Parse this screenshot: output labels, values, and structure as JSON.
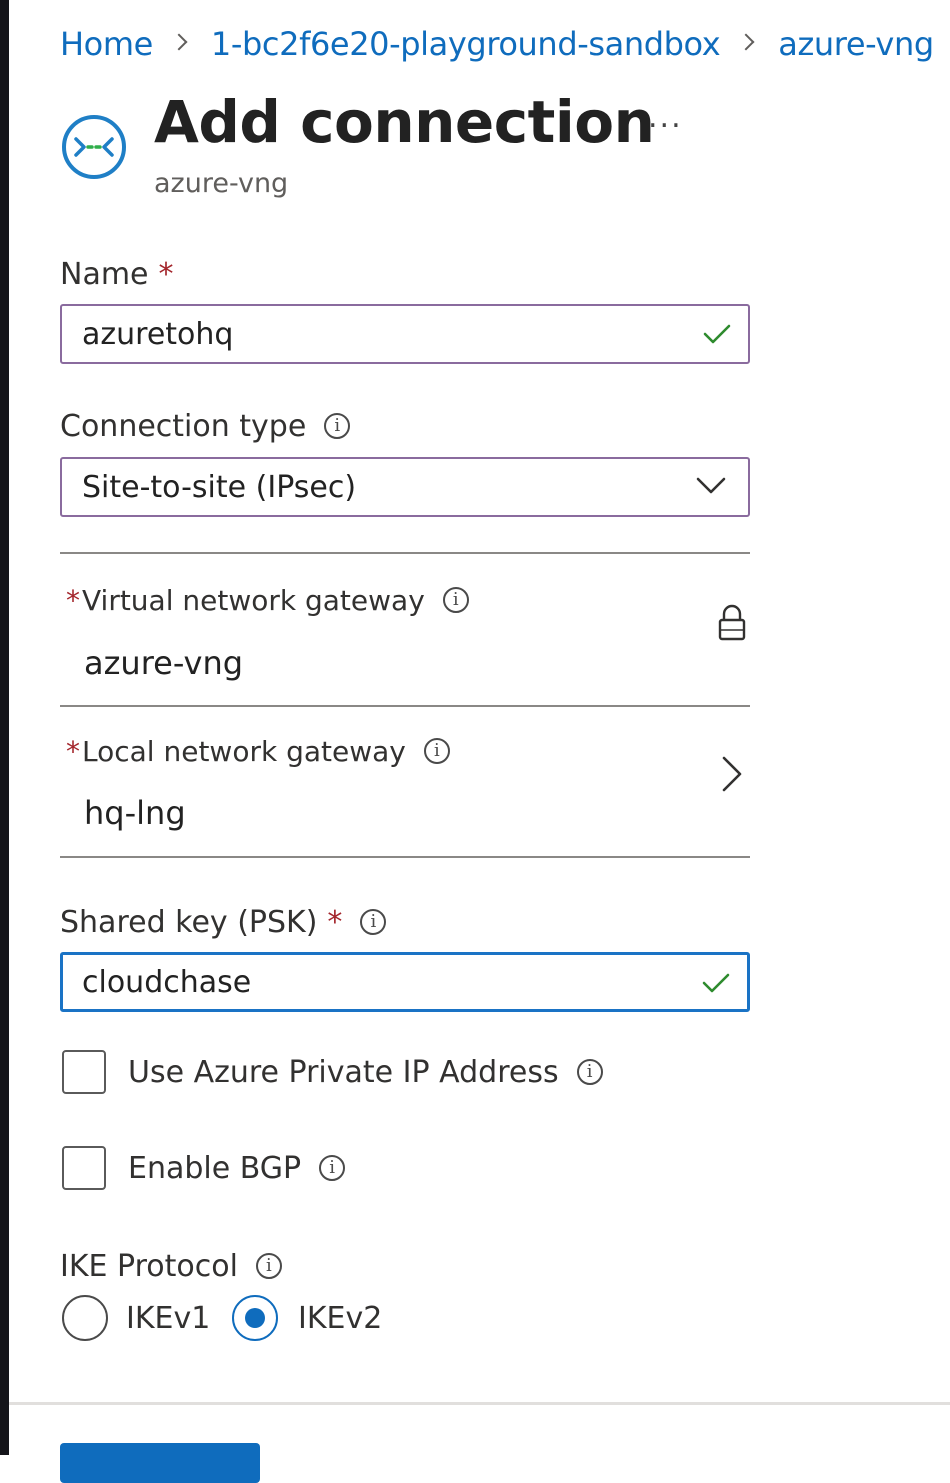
{
  "breadcrumb": [
    "Home",
    "1-bc2f6e20-playground-sandbox",
    "azure-vng"
  ],
  "header": {
    "title": "Add connection",
    "subtitle": "azure-vng",
    "more": "..."
  },
  "form": {
    "name": {
      "label": "Name",
      "required": "*",
      "value": "azuretohq"
    },
    "connection_type": {
      "label": "Connection type",
      "value": "Site-to-site (IPsec)"
    },
    "virtual_network_gateway": {
      "required": "*",
      "label": "Virtual network gateway",
      "value": "azure-vng",
      "locked": true
    },
    "local_network_gateway": {
      "required": "*",
      "label": "Local network gateway",
      "value": "hq-lng"
    },
    "shared_key": {
      "label": "Shared key (PSK)",
      "required": "*",
      "value": "cloudchase"
    },
    "use_private_ip": {
      "label": "Use Azure Private IP Address",
      "checked": false
    },
    "enable_bgp": {
      "label": "Enable BGP",
      "checked": false
    },
    "ike_protocol": {
      "label": "IKE Protocol",
      "options": [
        "IKEv1",
        "IKEv2"
      ],
      "selected": "IKEv2"
    }
  },
  "info_glyph": "i",
  "colors": {
    "link": "#0f6cbd",
    "required": "#a4262c",
    "valid_check": "#2e8b2e",
    "focus_border": "#1a73c5",
    "primary": "#0f6cbd"
  },
  "icons": [
    "connection-icon",
    "info-icon",
    "checkmark-icon",
    "chevron-down-icon",
    "lock-icon",
    "chevron-right-icon"
  ]
}
